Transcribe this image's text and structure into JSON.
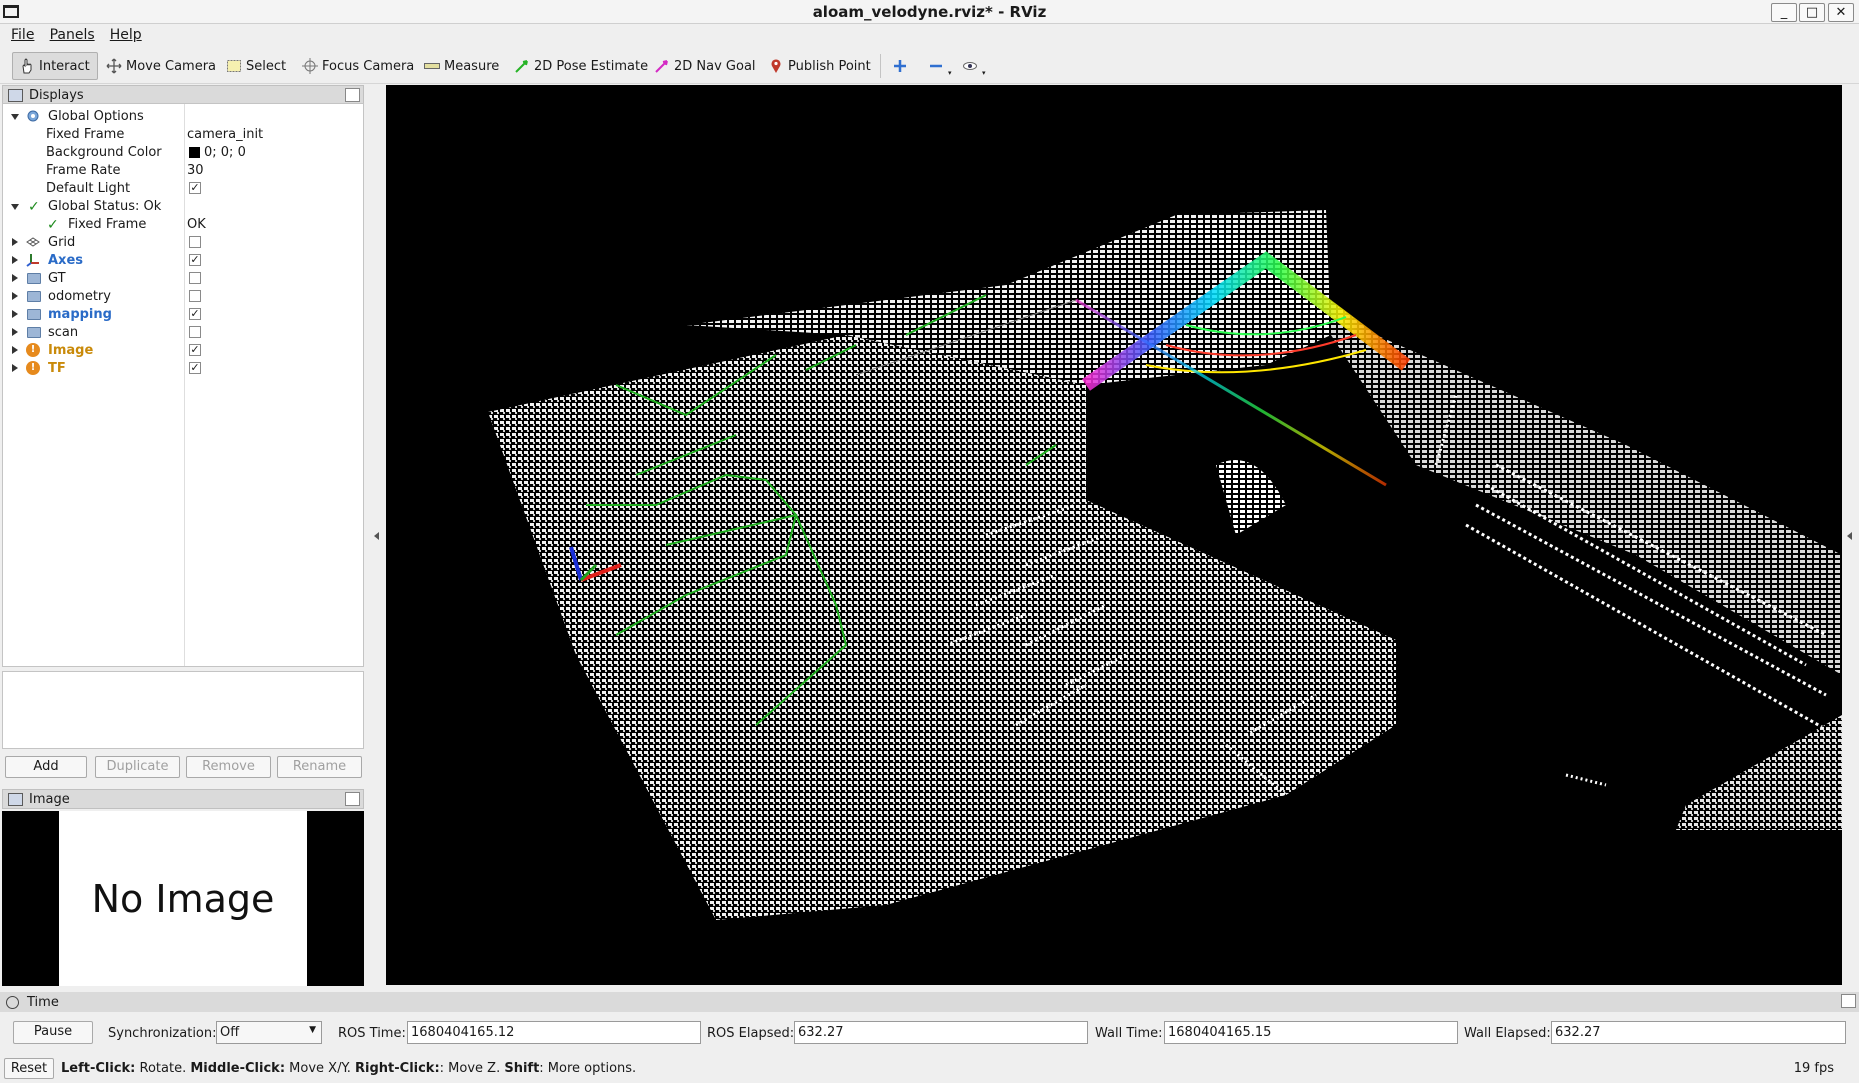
{
  "window": {
    "title": "aloam_velodyne.rviz* - RViz",
    "minimize": "_",
    "maximize": "□",
    "close": "✕"
  },
  "menu": [
    "File",
    "Panels",
    "Help"
  ],
  "toolbar": {
    "interact": "Interact",
    "move_camera": "Move Camera",
    "select": "Select",
    "focus_camera": "Focus Camera",
    "measure": "Measure",
    "pose_estimate": "2D Pose Estimate",
    "nav_goal": "2D Nav Goal",
    "publish_point": "Publish Point"
  },
  "displays": {
    "header": "Displays",
    "global_options": "Global Options",
    "fixed_frame_label": "Fixed Frame",
    "fixed_frame_value": "camera_init",
    "background_color_label": "Background Color",
    "background_color_value": "0; 0; 0",
    "background_color_swatch": "#000000",
    "frame_rate_label": "Frame Rate",
    "frame_rate_value": "30",
    "default_light_label": "Default Light",
    "default_light_checked": true,
    "global_status": "Global Status: Ok",
    "status_fixed_frame_label": "Fixed Frame",
    "status_fixed_frame_value": "OK",
    "items": [
      {
        "label": "Grid",
        "checked": false,
        "style": "normal",
        "icon": "grid-icon"
      },
      {
        "label": "Axes",
        "checked": true,
        "style": "blue",
        "icon": "axes-icon"
      },
      {
        "label": "GT",
        "checked": false,
        "style": "normal",
        "icon": "folder-icon"
      },
      {
        "label": "odometry",
        "checked": false,
        "style": "normal",
        "icon": "folder-icon"
      },
      {
        "label": "mapping",
        "checked": true,
        "style": "blue",
        "icon": "folder-icon"
      },
      {
        "label": "scan",
        "checked": false,
        "style": "normal",
        "icon": "folder-icon"
      },
      {
        "label": "Image",
        "checked": true,
        "style": "orange",
        "icon": "warning-icon"
      },
      {
        "label": "TF",
        "checked": true,
        "style": "orange",
        "icon": "warning-icon"
      }
    ],
    "buttons": {
      "add": "Add",
      "duplicate": "Duplicate",
      "remove": "Remove",
      "rename": "Rename"
    }
  },
  "image_panel": {
    "header": "Image",
    "placeholder": "No Image"
  },
  "time_panel": {
    "header": "Time",
    "pause": "Pause",
    "sync_label": "Synchronization:",
    "sync_value": "Off",
    "ros_time_label": "ROS Time:",
    "ros_time_value": "1680404165.12",
    "ros_elapsed_label": "ROS Elapsed:",
    "ros_elapsed_value": "632.27",
    "wall_time_label": "Wall Time:",
    "wall_time_value": "1680404165.15",
    "wall_elapsed_label": "Wall Elapsed:",
    "wall_elapsed_value": "632.27"
  },
  "status": {
    "reset": "Reset",
    "left_click": "Left-Click:",
    "left_click_desc": " Rotate. ",
    "middle_click": "Middle-Click:",
    "middle_click_desc": " Move X/Y. ",
    "right_click": "Right-Click:",
    "right_click_desc": ": Move Z. ",
    "shift": "Shift",
    "shift_desc": ": More options.",
    "fps": "19 fps"
  },
  "viewport": {
    "background": "#000000",
    "point_color": "#ffffff",
    "path_color": "#1fae1f"
  }
}
